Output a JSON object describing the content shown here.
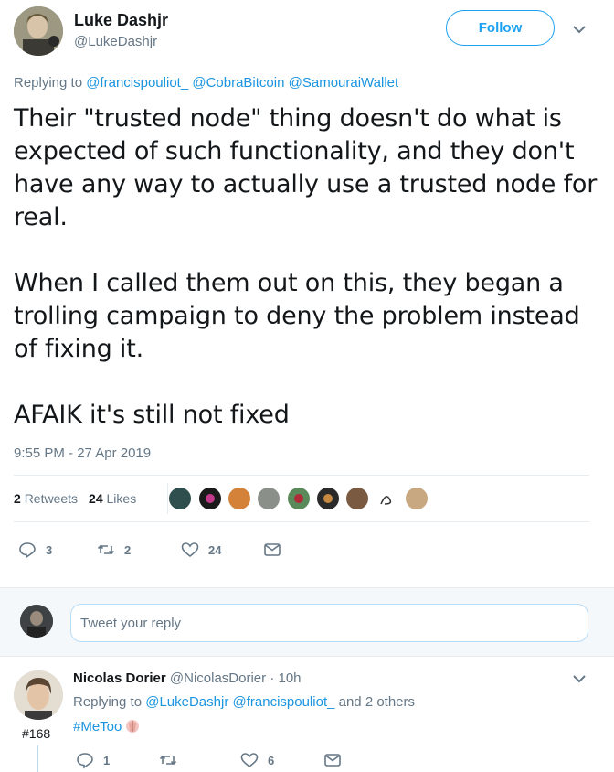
{
  "tweet": {
    "author_name": "Luke Dashjr",
    "author_handle": "@LukeDashjr",
    "follow_label": "Follow",
    "replying_prefix": "Replying to",
    "replying_to": [
      "@francispouliot_",
      "@CobraBitcoin",
      "@SamouraiWallet"
    ],
    "paragraphs": [
      "Their \"trusted node\" thing doesn't do what is expected of such functionality, and they don't have any way to actually use a trusted node for real.",
      "When I called them out on this, they began a trolling campaign to deny the problem instead of fixing it.",
      "AFAIK it's still not fixed"
    ],
    "timestamp": "9:55 PM - 27 Apr 2019",
    "retweets_count": "2",
    "retweets_label": "Retweets",
    "likes_count": "24",
    "likes_label": "Likes",
    "actions": {
      "replies": "3",
      "retweets": "2",
      "likes": "24"
    }
  },
  "reply_box": {
    "placeholder": "Tweet your reply"
  },
  "reply": {
    "rank": "#168",
    "author_name": "Nicolas Dorier",
    "author_handle": "@NicolasDorier",
    "separator": "·",
    "time": "10h",
    "replying_prefix": "Replying to",
    "replying_to": [
      "@LukeDashjr",
      "@francispouliot_"
    ],
    "others": "and 2 others",
    "text": "#MeToo",
    "actions": {
      "replies": "1",
      "retweets": "",
      "likes": "6"
    }
  },
  "colors": {
    "accent": "#1da1f2",
    "link": "#1b95e0",
    "secondary_text": "#657786",
    "border": "#e6ecf0"
  },
  "icons": [
    "chevron-down-icon",
    "reply-icon",
    "retweet-icon",
    "heart-icon",
    "message-icon",
    "emoji-icon"
  ]
}
